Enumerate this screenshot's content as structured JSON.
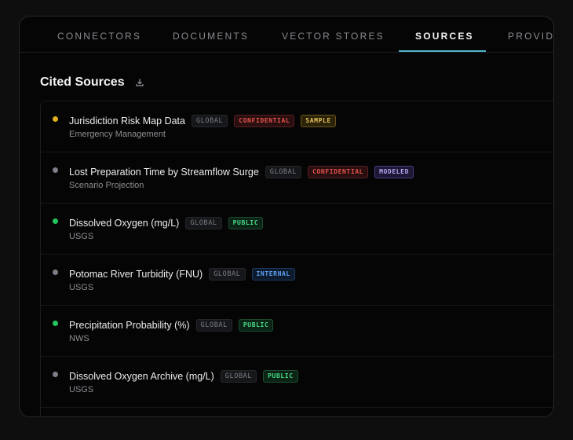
{
  "tabs": [
    {
      "label": "CONNECTORS"
    },
    {
      "label": "DOCUMENTS"
    },
    {
      "label": "VECTOR STORES"
    },
    {
      "label": "SOURCES"
    },
    {
      "label": "PROVIDERS"
    }
  ],
  "active_tab": "SOURCES",
  "section": {
    "title": "Cited Sources",
    "download_icon": "download-icon"
  },
  "colors": {
    "accent": "#4fb3c9",
    "status_yellow": "#e0b020",
    "status_gray": "#7c7f88",
    "status_green": "#22c55e"
  },
  "sources": [
    {
      "title": "Jurisdiction Risk Map Data",
      "subtitle": "Emergency Management",
      "status": "yellow",
      "badges": [
        {
          "text": "GLOBAL",
          "kind": "scope"
        },
        {
          "text": "CONFIDENTIAL",
          "kind": "confidential"
        },
        {
          "text": "SAMPLE",
          "kind": "sample"
        }
      ]
    },
    {
      "title": "Lost Preparation Time by Streamflow Surge",
      "subtitle": "Scenario Projection",
      "status": "gray",
      "badges": [
        {
          "text": "GLOBAL",
          "kind": "scope"
        },
        {
          "text": "CONFIDENTIAL",
          "kind": "confidential"
        },
        {
          "text": "MODELED",
          "kind": "modeled"
        }
      ]
    },
    {
      "title": "Dissolved Oxygen (mg/L)",
      "subtitle": "USGS",
      "status": "green",
      "badges": [
        {
          "text": "GLOBAL",
          "kind": "scope"
        },
        {
          "text": "PUBLIC",
          "kind": "public"
        }
      ]
    },
    {
      "title": "Potomac River Turbidity (FNU)",
      "subtitle": "USGS",
      "status": "gray",
      "badges": [
        {
          "text": "GLOBAL",
          "kind": "scope"
        },
        {
          "text": "INTERNAL",
          "kind": "internal"
        }
      ]
    },
    {
      "title": "Precipitation Probability (%)",
      "subtitle": "NWS",
      "status": "green",
      "badges": [
        {
          "text": "GLOBAL",
          "kind": "scope"
        },
        {
          "text": "PUBLIC",
          "kind": "public"
        }
      ]
    },
    {
      "title": "Dissolved Oxygen Archive (mg/L)",
      "subtitle": "USGS",
      "status": "gray",
      "badges": [
        {
          "text": "GLOBAL",
          "kind": "scope"
        },
        {
          "text": "PUBLIC",
          "kind": "public"
        }
      ]
    }
  ]
}
